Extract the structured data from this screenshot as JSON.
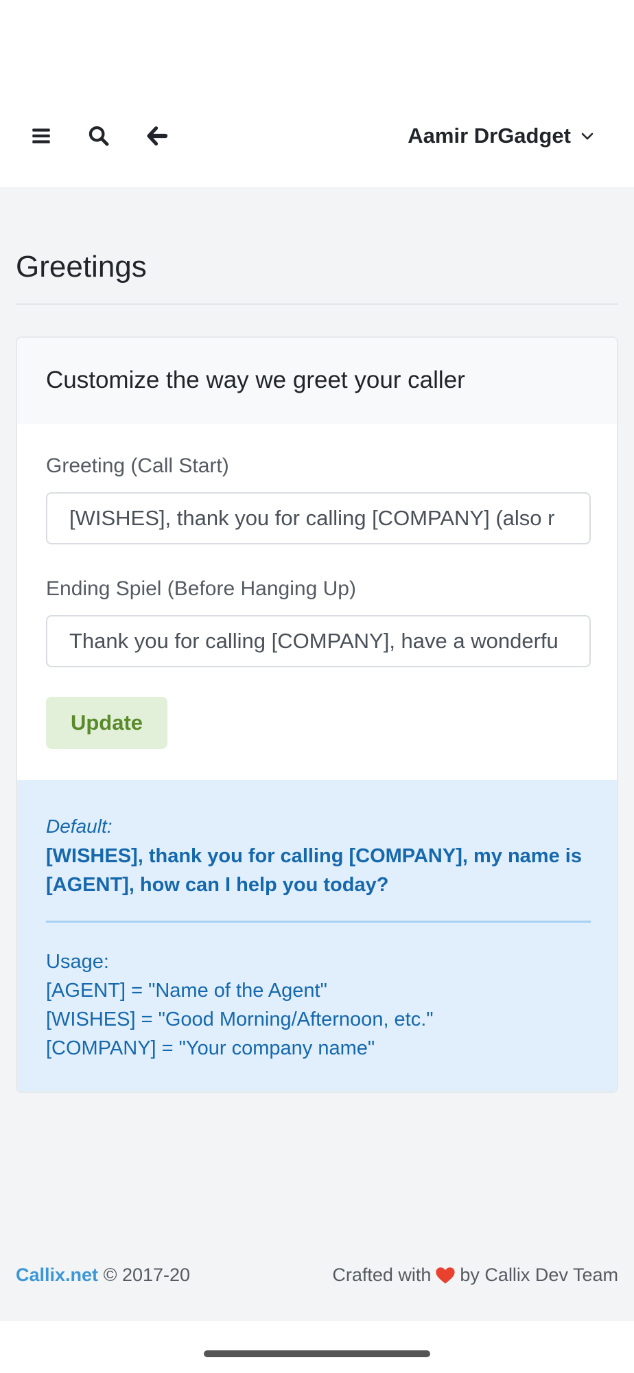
{
  "header": {
    "user_name": "Aamir DrGadget"
  },
  "page": {
    "title": "Greetings"
  },
  "card": {
    "header": "Customize the way we greet your caller",
    "greeting_label": "Greeting (Call Start)",
    "greeting_value": "[WISHES], thank you for calling [COMPANY] (also r",
    "ending_label": "Ending Spiel (Before Hanging Up)",
    "ending_value": "Thank you for calling [COMPANY], have a wonderfu",
    "update_label": "Update"
  },
  "info": {
    "default_label": "Default:",
    "default_text": "[WISHES], thank you for calling [COMPANY], my name is [AGENT], how can I help you today?",
    "usage_title": "Usage:",
    "usage_lines": [
      "[AGENT] = \"Name of the Agent\"",
      "[WISHES] = \"Good Morning/Afternoon, etc.\"",
      "[COMPANY] = \"Your company name\""
    ]
  },
  "footer": {
    "brand": "Callix.net",
    "copyright": "© 2017-20",
    "crafted_prefix": "Crafted with",
    "crafted_suffix": "by Callix Dev Team"
  },
  "icons": {
    "menu": "bars-icon",
    "search": "search-icon",
    "back": "arrow-left-icon",
    "dropdown": "chevron-down-icon",
    "heart": "heart-icon"
  },
  "colors": {
    "link": "#3c97d8",
    "info_bg": "#e1effc",
    "info_text": "#1668ad",
    "button_bg": "#e2f0d9",
    "button_text": "#5a8a2a",
    "heart": "#e8412e"
  }
}
